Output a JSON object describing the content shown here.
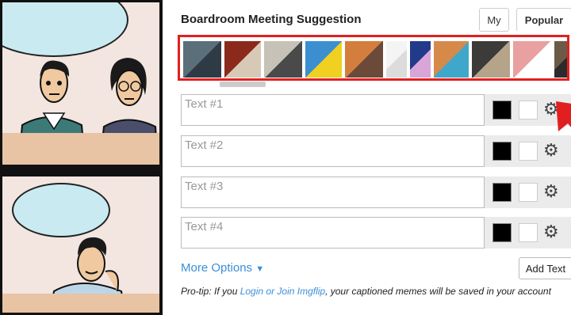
{
  "editor": {
    "title": "Boardroom Meeting Suggestion",
    "tabs": [
      {
        "label": "My",
        "active": false
      },
      {
        "label": "Popular",
        "active": true
      }
    ],
    "thumbnails": [
      {
        "name": "thumb-1",
        "colors": [
          "#5b6f7a",
          "#2e3b45"
        ]
      },
      {
        "name": "thumb-2",
        "colors": [
          "#8b2a1c",
          "#d7c9b5"
        ]
      },
      {
        "name": "thumb-3",
        "colors": [
          "#c7c2b8",
          "#4a4a4a"
        ]
      },
      {
        "name": "thumb-4",
        "colors": [
          "#3b8fd1",
          "#f0d020"
        ]
      },
      {
        "name": "thumb-5",
        "colors": [
          "#d37e3c",
          "#6b4a3a"
        ]
      },
      {
        "name": "thumb-6",
        "colors": [
          "#f4f4f4",
          "#dcdcdc"
        ]
      },
      {
        "name": "thumb-7",
        "colors": [
          "#223a8a",
          "#d9a5d8"
        ]
      },
      {
        "name": "thumb-8",
        "colors": [
          "#d68a4a",
          "#3fa7c9"
        ]
      },
      {
        "name": "thumb-9",
        "colors": [
          "#3d3a3a",
          "#b5a48a"
        ]
      },
      {
        "name": "thumb-10",
        "colors": [
          "#e8a0a0",
          "#ffffff"
        ]
      },
      {
        "name": "thumb-11",
        "colors": [
          "#6b5a48",
          "#2b2b2b"
        ]
      }
    ],
    "text_fields": [
      {
        "placeholder": "Text #1",
        "value": ""
      },
      {
        "placeholder": "Text #2",
        "value": ""
      },
      {
        "placeholder": "Text #3",
        "value": ""
      },
      {
        "placeholder": "Text #4",
        "value": ""
      }
    ],
    "colors": {
      "primary": "#000000",
      "outline": "#ffffff",
      "accent": "#3a8fd6",
      "highlight": "#e02020"
    },
    "more_options": "More Options",
    "add_text": "Add Text",
    "protip": {
      "prefix": "Pro-tip: If you ",
      "link": "Login or Join Imgflip",
      "suffix": ", your captioned memes will be saved in your account"
    }
  }
}
